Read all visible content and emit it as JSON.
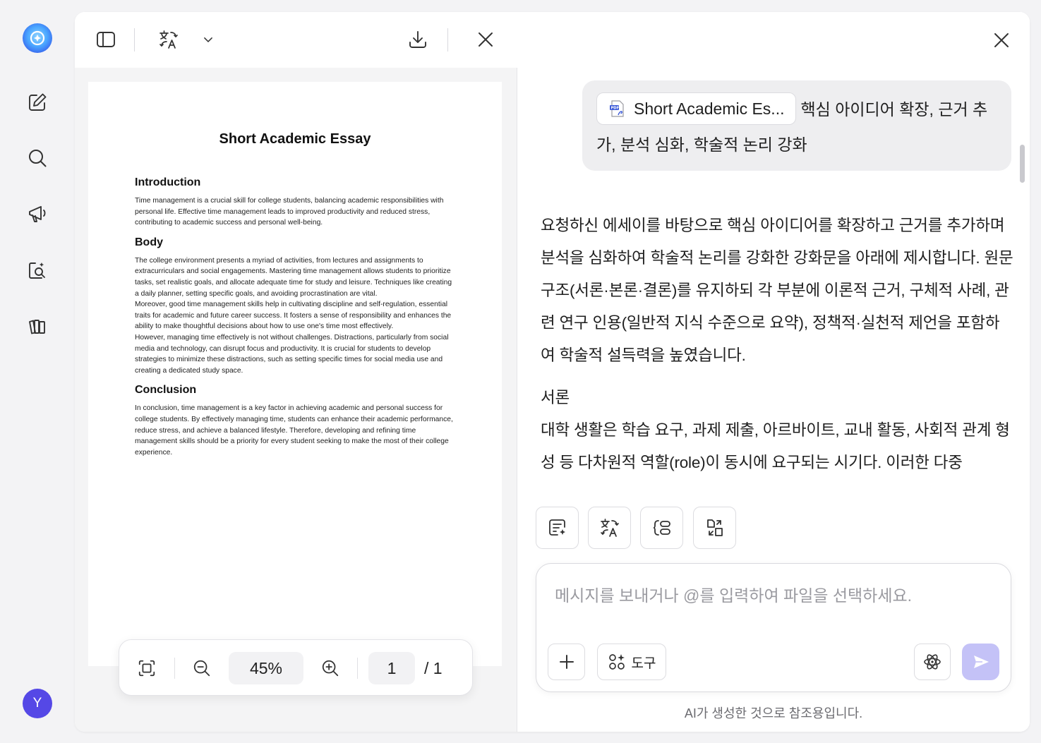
{
  "colors": {
    "accent": "#5548e6",
    "send_disabled": "#c4c2f7",
    "page_bg": "#f3f3f5"
  },
  "sidebar": {
    "items": [
      {
        "name": "logo",
        "icon": "assistant-logo-icon"
      },
      {
        "name": "new-chat",
        "icon": "edit-icon"
      },
      {
        "name": "search",
        "icon": "search-icon"
      },
      {
        "name": "announce",
        "icon": "megaphone-icon"
      },
      {
        "name": "doc-search",
        "icon": "document-search-icon"
      },
      {
        "name": "library",
        "icon": "library-icon"
      }
    ],
    "avatar_initial": "Y"
  },
  "pdf_viewer": {
    "toolbar": {
      "icons": [
        "sidebar-toggle-icon",
        "translate-icon",
        "chevron-down-icon",
        "download-icon",
        "close-icon"
      ]
    },
    "document": {
      "title": "Short Academic Essay",
      "sections": [
        {
          "heading": "Introduction",
          "paragraphs": [
            "Time management is a crucial skill for college students, balancing academic responsibilities with personal life. Effective time management leads to improved productivity and reduced stress, contributing to academic success and personal well-being."
          ]
        },
        {
          "heading": "Body",
          "paragraphs": [
            "The college environment presents a myriad of activities, from lectures and assignments to extracurriculars and social engagements. Mastering time management allows students to prioritize tasks, set realistic goals, and allocate adequate time for study and leisure. Techniques like creating a daily planner, setting specific goals, and avoiding procrastination are vital.",
            "Moreover, good time management skills help in cultivating discipline and self-regulation, essential traits for academic and future career success. It fosters a sense of responsibility and enhances the ability to make thoughtful decisions about how to use one's time most effectively.",
            "However, managing time effectively is not without challenges. Distractions, particularly from social media and technology, can disrupt focus and productivity. It is crucial for students to develop strategies to minimize these distractions, such as setting specific times for social media use and creating a dedicated study space."
          ]
        },
        {
          "heading": "Conclusion",
          "paragraphs": [
            "In conclusion, time management is a key factor in achieving academic and personal success for college students. By effectively managing time, students can enhance their academic performance, reduce stress, and achieve a balanced lifestyle. Therefore, developing and refining time management skills should be a priority for every student seeking to make the most of their college experience."
          ]
        }
      ]
    },
    "zoom_bar": {
      "zoom": "45%",
      "page_current": "1",
      "page_total": "/ 1"
    }
  },
  "chat": {
    "user_message": {
      "file_name": "Short Academic Es...",
      "text": "핵심 아이디어 확장, 근거 추가, 분석 심화, 학술적 논리 강화"
    },
    "answer": {
      "intro": "요청하신 에세이를 바탕으로 핵심 아이디어를 확장하고 근거를 추가하며 분석을 심화하여 학술적 논리를 강화한 강화문을 아래에 제시합니다. 원문 구조(서론·본론·결론)를 유지하되 각 부분에 이론적 근거, 구체적 사례, 관련 연구 인용(일반적 지식 수준으로 요약), 정책적·실천적 제언을 포함하여 학술적 설득력을 높였습니다.",
      "section_title": "서론",
      "section_text": "대학 생활은 학습 요구, 과제 제출, 아르바이트, 교내 활동, 사회적 관계 형성 등 다차원적 역할(role)이 동시에 요구되는 시기다. 이러한 다중"
    },
    "quick_tools": [
      "summarize-icon",
      "translate-icon",
      "outline-icon",
      "convert-icon"
    ],
    "input": {
      "placeholder": "메시지를 보내거나 @를 입력하여 파일을 선택하세요.",
      "value": ""
    },
    "tools_label": "도구",
    "disclaimer": "AI가 생성한 것으로 참조용입니다."
  }
}
